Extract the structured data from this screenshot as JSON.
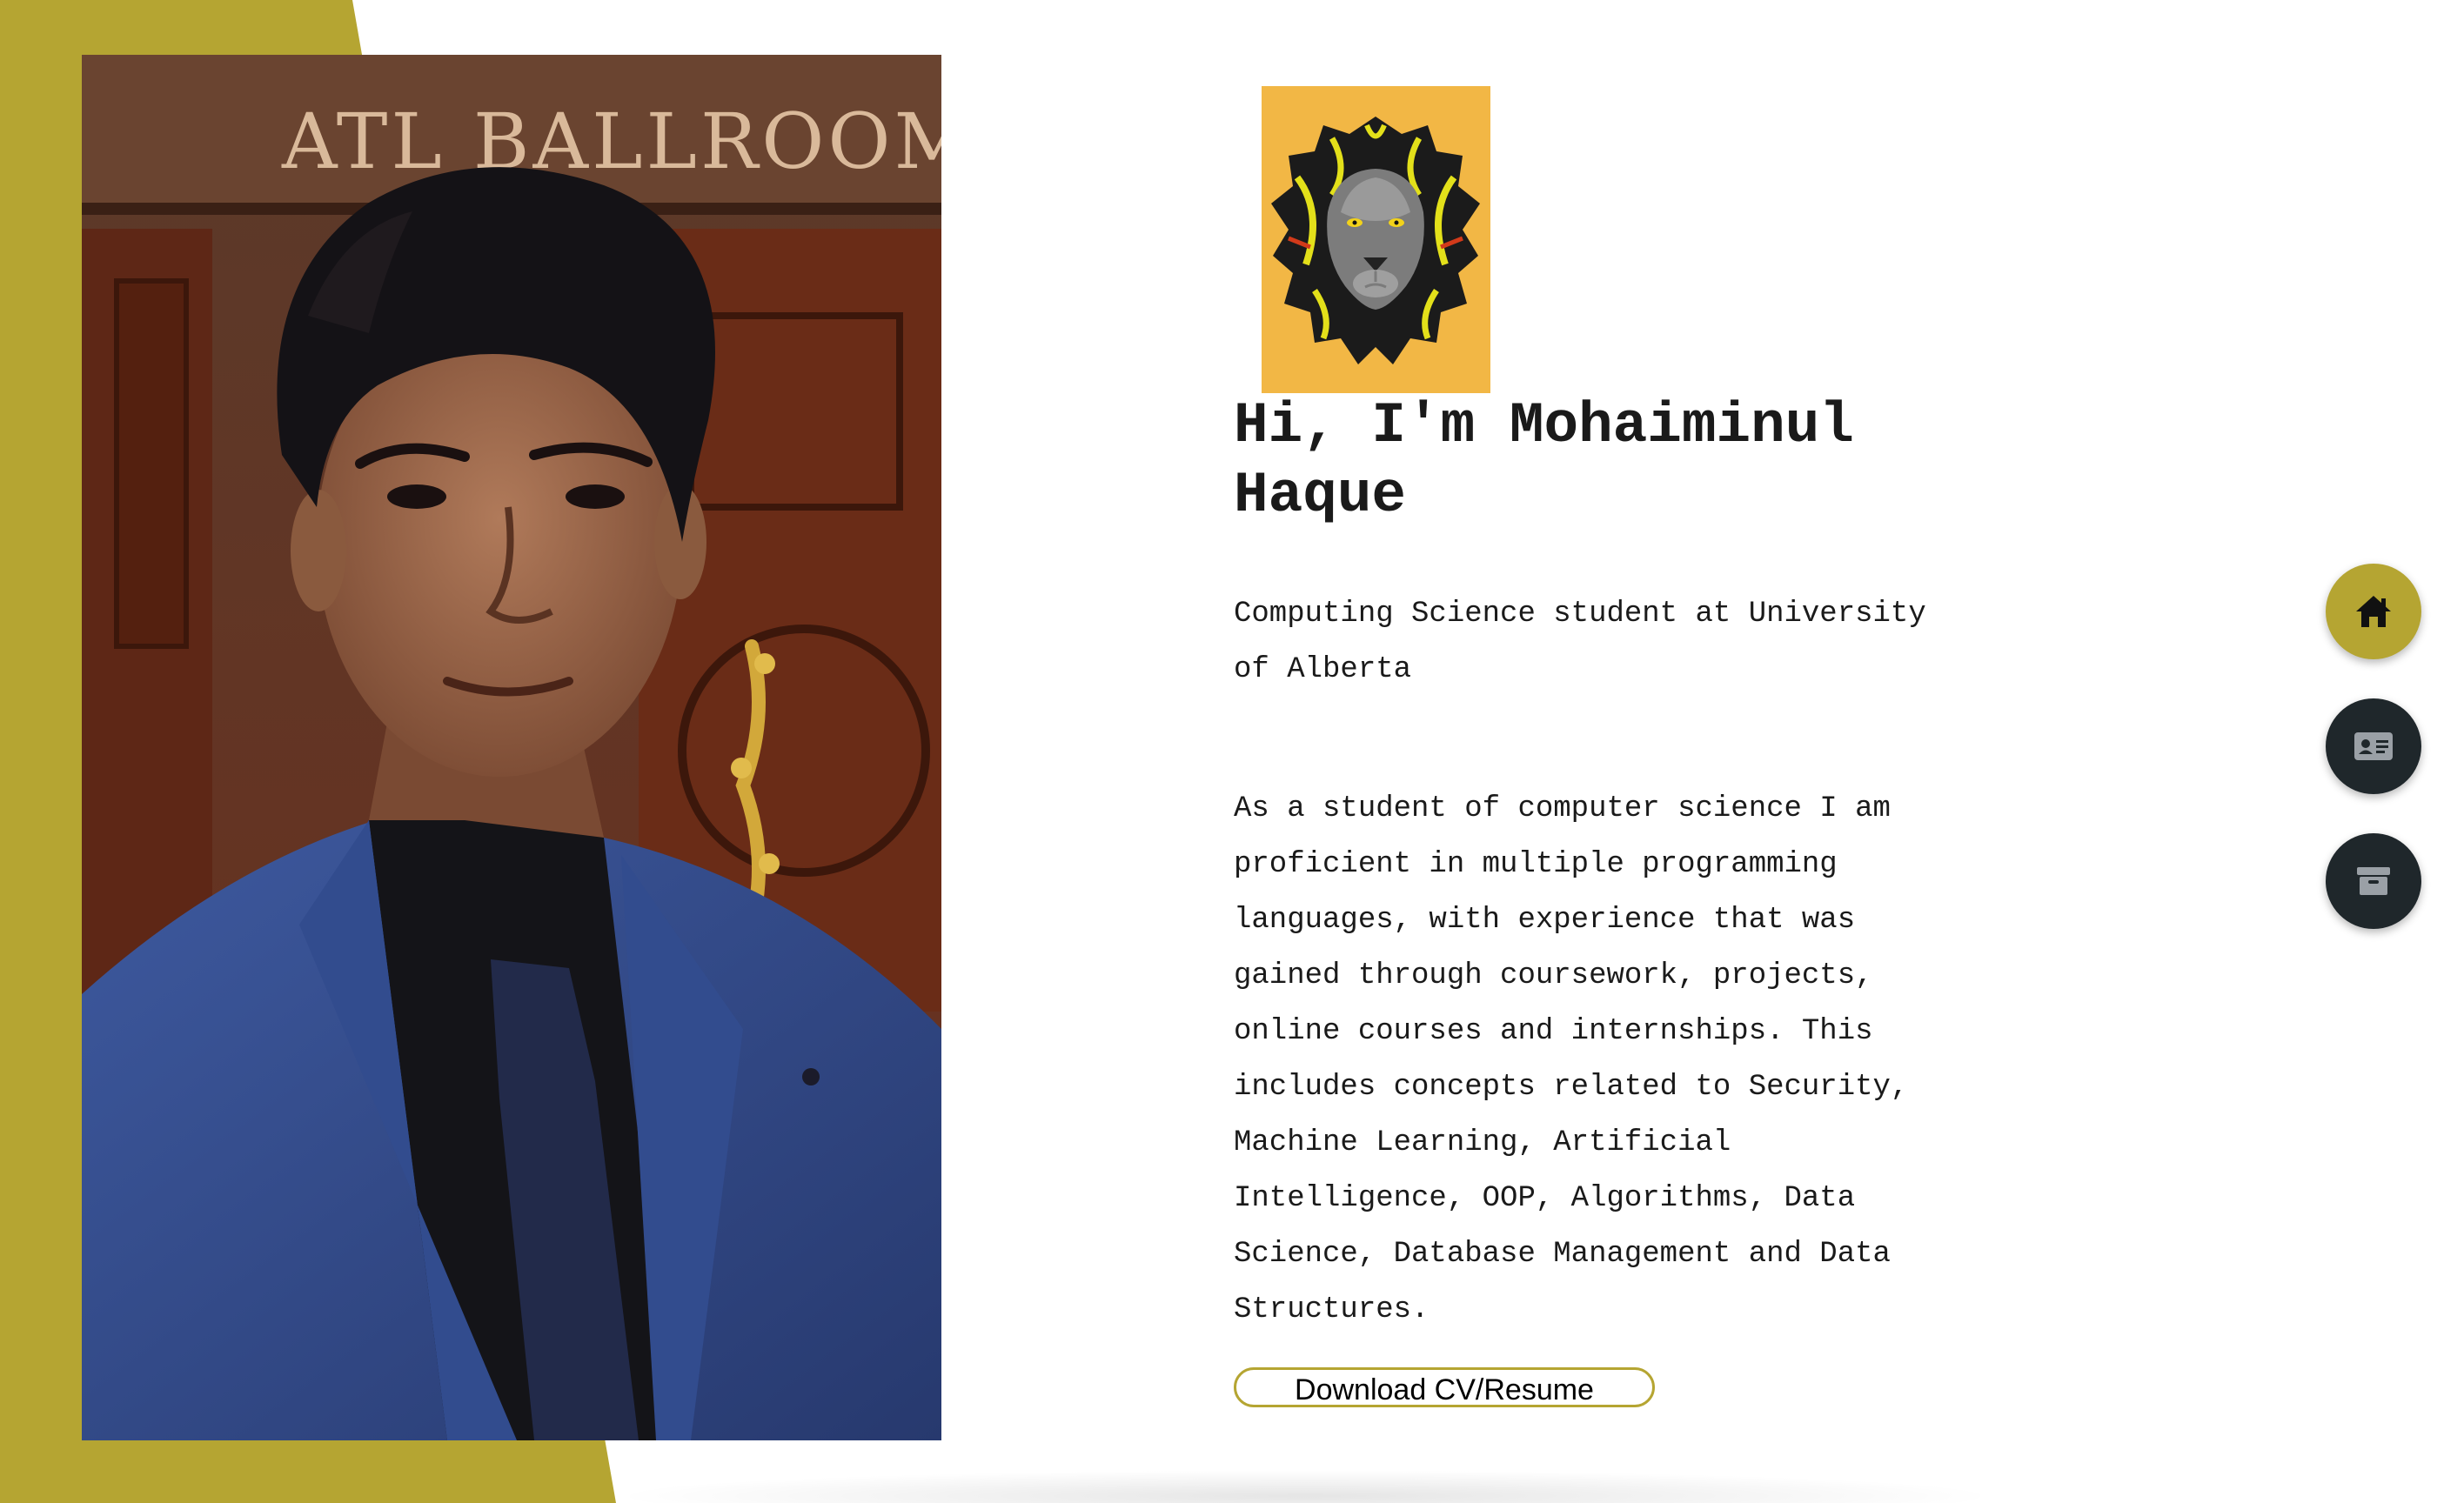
{
  "hero": {
    "title": "Hi, I'm Mohaiminul Haque",
    "subtitle": "Computing Science student at University of Alberta",
    "bio": "As a student of computer science I am proficient in multiple programming languages, with experience that was gained through coursework, projects, online courses and internships. This includes concepts related to Security, Machine Learning, Artificial Intelligence, OOP, Algorithms, Data Science, Database Management and Data Structures.",
    "download_label": "Download CV/Resume"
  },
  "photo": {
    "sign_text": "ATL     BALLROOM"
  },
  "nav": [
    {
      "name": "home",
      "icon": "home-icon",
      "active": true
    },
    {
      "name": "about",
      "icon": "id-card-icon",
      "active": false
    },
    {
      "name": "portfolio",
      "icon": "archive-icon",
      "active": false
    }
  ],
  "colors": {
    "accent": "#b5a532",
    "dark": "#1f272b",
    "logo_bg": "#f2b745",
    "text": "#1a1a1a"
  }
}
